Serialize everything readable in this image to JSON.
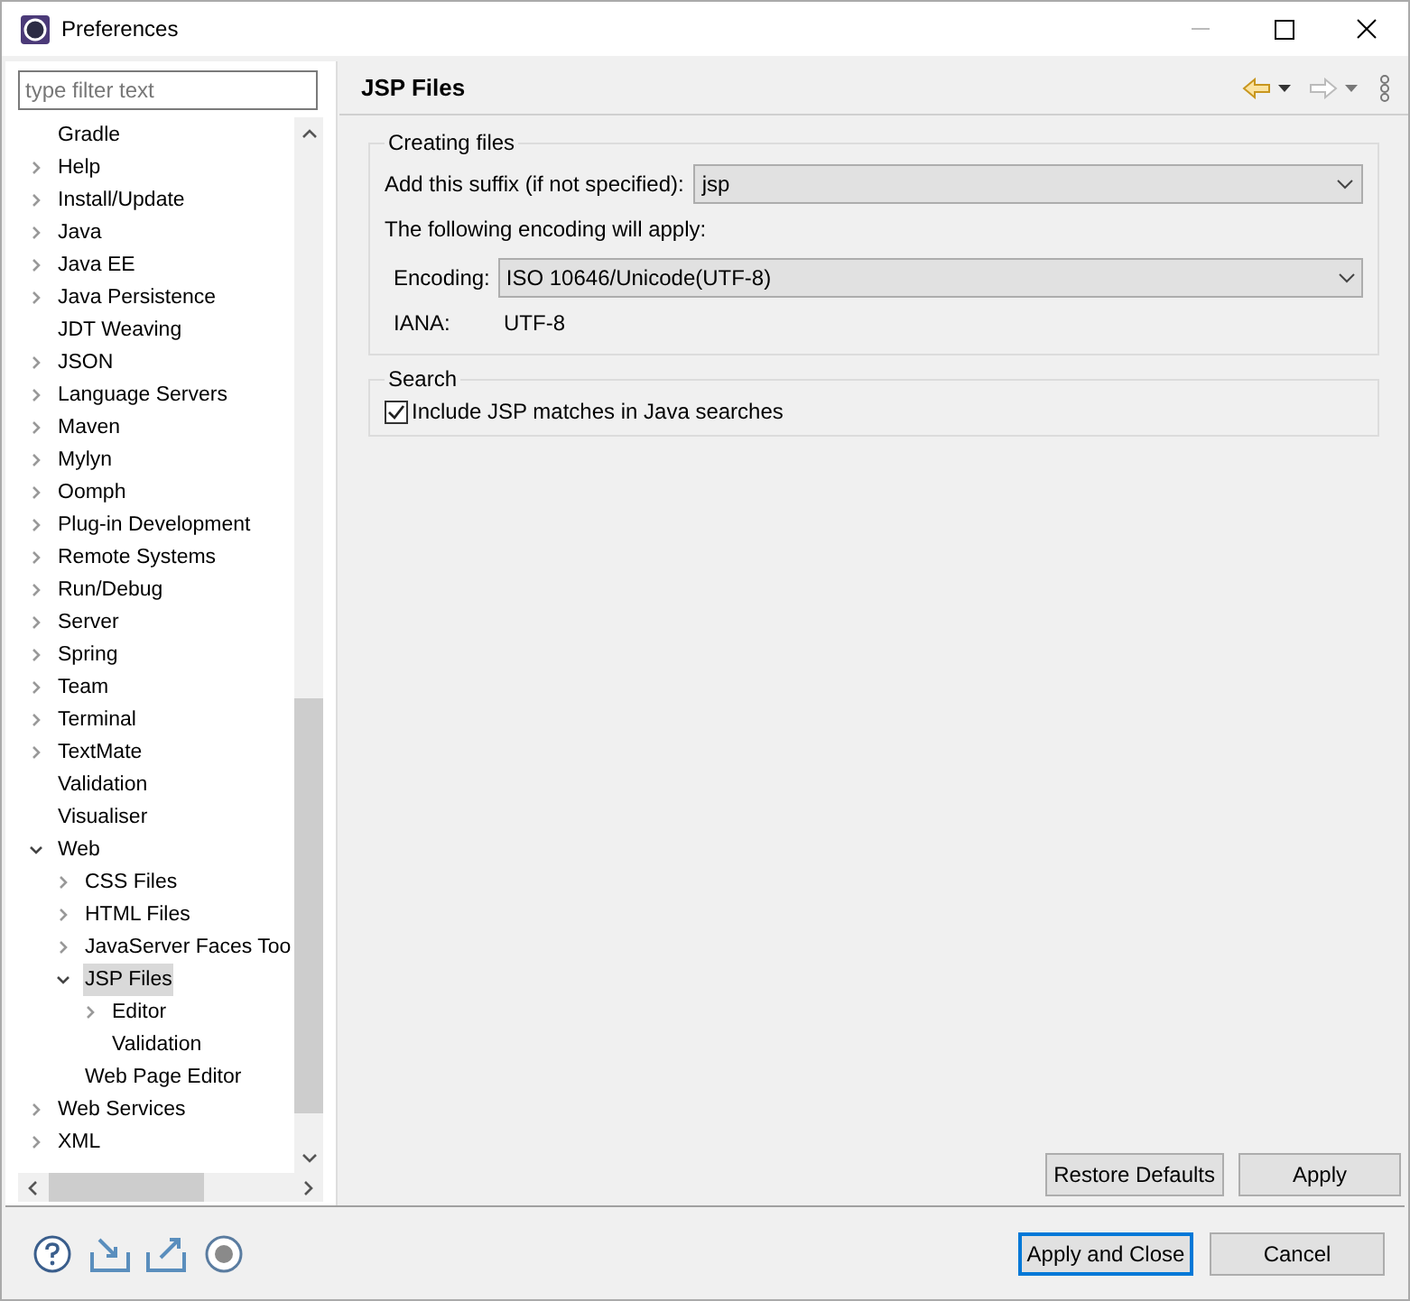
{
  "window": {
    "title": "Preferences"
  },
  "filter": {
    "placeholder": "type filter text"
  },
  "tree": [
    {
      "label": "Gradle",
      "kind": "leaf",
      "selected": false
    },
    {
      "label": "Help",
      "kind": "collapsed",
      "selected": false
    },
    {
      "label": "Install/Update",
      "kind": "collapsed",
      "selected": false
    },
    {
      "label": "Java",
      "kind": "collapsed",
      "selected": false
    },
    {
      "label": "Java EE",
      "kind": "collapsed",
      "selected": false
    },
    {
      "label": "Java Persistence",
      "kind": "collapsed",
      "selected": false
    },
    {
      "label": "JDT Weaving",
      "kind": "leaf",
      "selected": false
    },
    {
      "label": "JSON",
      "kind": "collapsed",
      "selected": false
    },
    {
      "label": "Language Servers",
      "kind": "collapsed",
      "selected": false
    },
    {
      "label": "Maven",
      "kind": "collapsed",
      "selected": false
    },
    {
      "label": "Mylyn",
      "kind": "collapsed",
      "selected": false
    },
    {
      "label": "Oomph",
      "kind": "collapsed",
      "selected": false
    },
    {
      "label": "Plug-in Development",
      "kind": "collapsed",
      "selected": false
    },
    {
      "label": "Remote Systems",
      "kind": "collapsed",
      "selected": false
    },
    {
      "label": "Run/Debug",
      "kind": "collapsed",
      "selected": false
    },
    {
      "label": "Server",
      "kind": "collapsed",
      "selected": false
    },
    {
      "label": "Spring",
      "kind": "collapsed",
      "selected": false
    },
    {
      "label": "Team",
      "kind": "collapsed",
      "selected": false
    },
    {
      "label": "Terminal",
      "kind": "collapsed",
      "selected": false
    },
    {
      "label": "TextMate",
      "kind": "collapsed",
      "selected": false
    },
    {
      "label": "Validation",
      "kind": "leaf",
      "selected": false
    },
    {
      "label": "Visualiser",
      "kind": "leaf",
      "selected": false
    },
    {
      "label": "Web",
      "kind": "expanded",
      "selected": false,
      "children": [
        {
          "label": "CSS Files",
          "kind": "collapsed",
          "selected": false
        },
        {
          "label": "HTML Files",
          "kind": "collapsed",
          "selected": false
        },
        {
          "label": "JavaServer Faces Too",
          "kind": "collapsed",
          "selected": false
        },
        {
          "label": "JSP Files",
          "kind": "expanded",
          "selected": true,
          "children": [
            {
              "label": "Editor",
              "kind": "collapsed",
              "selected": false
            },
            {
              "label": "Validation",
              "kind": "leaf",
              "selected": false
            }
          ]
        },
        {
          "label": "Web Page Editor",
          "kind": "leaf",
          "selected": false
        }
      ]
    },
    {
      "label": "Web Services",
      "kind": "collapsed",
      "selected": false
    },
    {
      "label": "XML",
      "kind": "collapsed",
      "selected": false
    }
  ],
  "page": {
    "title": "JSP Files",
    "creating_files": {
      "legend": "Creating files",
      "suffix_label": "Add this suffix (if not specified):",
      "suffix_value": "jsp",
      "encoding_note": "The following encoding will apply:",
      "encoding_label": "Encoding:",
      "encoding_value": "ISO 10646/Unicode(UTF-8)",
      "iana_label": "IANA:",
      "iana_value": "UTF-8"
    },
    "search": {
      "legend": "Search",
      "include_label": "Include JSP matches in Java searches",
      "checked": true
    },
    "buttons": [
      "Restore Defaults",
      "Apply"
    ]
  },
  "footer_buttons": [
    {
      "label": "Apply and Close",
      "default": true
    },
    {
      "label": "Cancel",
      "default": false
    }
  ]
}
